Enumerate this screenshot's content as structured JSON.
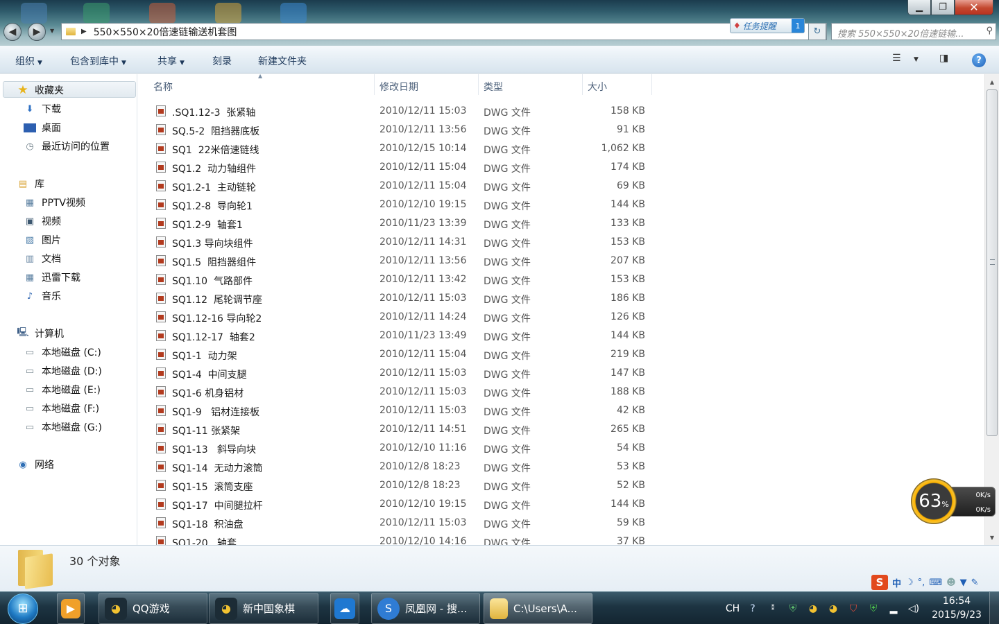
{
  "window": {
    "address_path": "550×550×20倍速链输送机套图",
    "search_placeholder": "搜索 550×550×20倍速链输...",
    "task_notice": "任务提醒",
    "task_notice_count": "1",
    "minimize": "▁",
    "maximize": "❐",
    "close": "✕"
  },
  "commands": {
    "organize": "组织",
    "include_in_library": "包含到库中",
    "share": "共享",
    "burn": "刻录",
    "new_folder": "新建文件夹"
  },
  "nav": {
    "favorites": "收藏夹",
    "downloads": "下载",
    "desktop": "桌面",
    "recent": "最近访问的位置",
    "libraries": "库",
    "pptv": "PPTV视频",
    "videos": "视频",
    "pictures": "图片",
    "documents": "文档",
    "thunder": "迅雷下载",
    "music": "音乐",
    "computer": "计算机",
    "disk_c": "本地磁盘 (C:)",
    "disk_d": "本地磁盘 (D:)",
    "disk_e": "本地磁盘 (E:)",
    "disk_f": "本地磁盘 (F:)",
    "disk_g": "本地磁盘 (G:)",
    "network": "网络"
  },
  "columns": {
    "name": "名称",
    "modified": "修改日期",
    "type": "类型",
    "size": "大小"
  },
  "files": [
    {
      "name": ".SQ1.12-3  张紧轴",
      "modified": "2010/12/11 15:03",
      "type": "DWG 文件",
      "size": "158 KB"
    },
    {
      "name": "SQ.5-2  阻挡器底板",
      "modified": "2010/12/11 13:56",
      "type": "DWG 文件",
      "size": "91 KB"
    },
    {
      "name": "SQ1  22米倍速链线",
      "modified": "2010/12/15 10:14",
      "type": "DWG 文件",
      "size": "1,062 KB"
    },
    {
      "name": "SQ1.2  动力轴组件",
      "modified": "2010/12/11 15:04",
      "type": "DWG 文件",
      "size": "174 KB"
    },
    {
      "name": "SQ1.2-1  主动链轮",
      "modified": "2010/12/11 15:04",
      "type": "DWG 文件",
      "size": "69 KB"
    },
    {
      "name": "SQ1.2-8  导向轮1",
      "modified": "2010/12/10 19:15",
      "type": "DWG 文件",
      "size": "144 KB"
    },
    {
      "name": "SQ1.2-9  轴套1",
      "modified": "2010/11/23 13:39",
      "type": "DWG 文件",
      "size": "133 KB"
    },
    {
      "name": "SQ1.3 导向块组件",
      "modified": "2010/12/11 14:31",
      "type": "DWG 文件",
      "size": "153 KB"
    },
    {
      "name": "SQ1.5  阻挡器组件",
      "modified": "2010/12/11 13:56",
      "type": "DWG 文件",
      "size": "207 KB"
    },
    {
      "name": "SQ1.10  气路部件",
      "modified": "2010/12/11 13:42",
      "type": "DWG 文件",
      "size": "153 KB"
    },
    {
      "name": "SQ1.12  尾轮调节座",
      "modified": "2010/12/11 15:03",
      "type": "DWG 文件",
      "size": "186 KB"
    },
    {
      "name": "SQ1.12-16 导向轮2",
      "modified": "2010/12/11 14:24",
      "type": "DWG 文件",
      "size": "126 KB"
    },
    {
      "name": "SQ1.12-17  轴套2",
      "modified": "2010/11/23 13:49",
      "type": "DWG 文件",
      "size": "144 KB"
    },
    {
      "name": "SQ1-1  动力架",
      "modified": "2010/12/11 15:04",
      "type": "DWG 文件",
      "size": "219 KB"
    },
    {
      "name": "SQ1-4  中间支腿",
      "modified": "2010/12/11 15:03",
      "type": "DWG 文件",
      "size": "147 KB"
    },
    {
      "name": "SQ1-6 机身铝材",
      "modified": "2010/12/11 15:03",
      "type": "DWG 文件",
      "size": "188 KB"
    },
    {
      "name": "SQ1-9   铝材连接板",
      "modified": "2010/12/11 15:03",
      "type": "DWG 文件",
      "size": "42 KB"
    },
    {
      "name": "SQ1-11 张紧架",
      "modified": "2010/12/11 14:51",
      "type": "DWG 文件",
      "size": "265 KB"
    },
    {
      "name": "SQ1-13   斜导向块",
      "modified": "2010/12/10 11:16",
      "type": "DWG 文件",
      "size": "54 KB"
    },
    {
      "name": "SQ1-14  无动力滚筒",
      "modified": "2010/12/8 18:23",
      "type": "DWG 文件",
      "size": "53 KB"
    },
    {
      "name": "SQ1-15  滚筒支座",
      "modified": "2010/12/8 18:23",
      "type": "DWG 文件",
      "size": "52 KB"
    },
    {
      "name": "SQ1-17  中间腿拉杆",
      "modified": "2010/12/10 19:15",
      "type": "DWG 文件",
      "size": "144 KB"
    },
    {
      "name": "SQ1-18  积油盘",
      "modified": "2010/12/11 15:03",
      "type": "DWG 文件",
      "size": "59 KB"
    },
    {
      "name": "SQ1-20   轴套",
      "modified": "2010/12/10 14:16",
      "type": "DWG 文件",
      "size": "37 KB"
    }
  ],
  "details": {
    "count": "30 个对象"
  },
  "netmon": {
    "percent": "63",
    "percent_unit": "%",
    "up": "0K/s",
    "down": "0K/s"
  },
  "ime": {
    "logo": "S",
    "lang": "中",
    "moon": "☽",
    "punct": "°,"
  },
  "taskbar": {
    "qq_game": "QQ游戏",
    "chess": "新中国象棋",
    "browser": "凤凰网 - 搜...",
    "explorer": "C:\\Users\\A..."
  },
  "tray": {
    "lang": "CH",
    "time": "16:54",
    "date": "2015/9/23"
  },
  "colors": {
    "accent": "#1e395b",
    "titlebar": "#2f5c6c",
    "taskbar": "#1d3442",
    "dwg_icon": "#b23a1e"
  }
}
